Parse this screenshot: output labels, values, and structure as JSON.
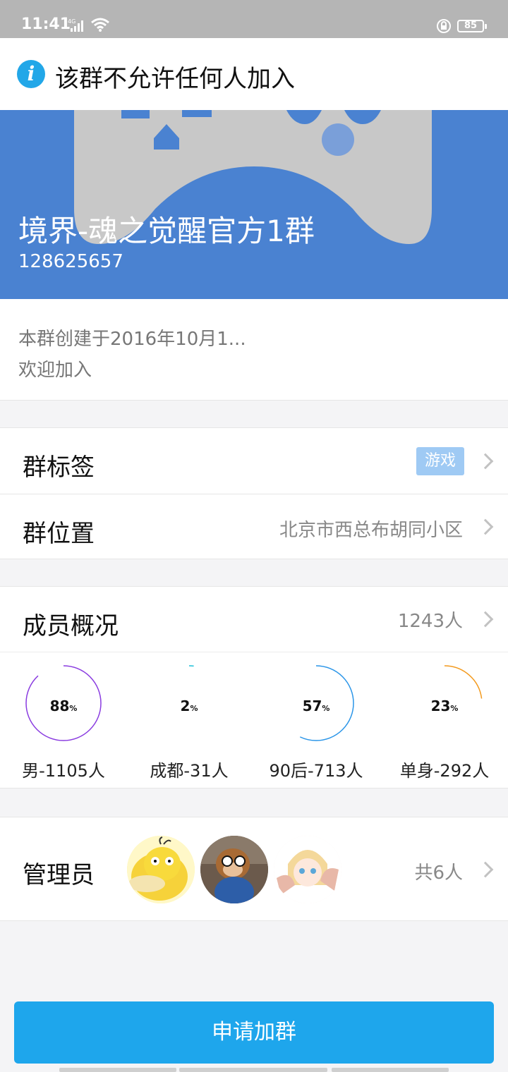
{
  "status_bar": {
    "time": "11:41",
    "network": "4G",
    "battery": "85"
  },
  "notice": {
    "icon": "info-icon",
    "text": "该群不允许任何人加入"
  },
  "group": {
    "name": "境界-魂之觉醒官方1群",
    "id": "128625657"
  },
  "intro": {
    "line1": "本群创建于2016年10月1...",
    "line2": "欢迎加入"
  },
  "tags": {
    "label": "群标签",
    "value": "游戏"
  },
  "location": {
    "label": "群位置",
    "value": "北京市西总布胡同小区"
  },
  "members": {
    "label": "成员概况",
    "count": "1243人",
    "stats": [
      {
        "percent": 88,
        "percent_text": "88",
        "label": "男-1105人",
        "color": "#8a3ce0"
      },
      {
        "percent": 2,
        "percent_text": "2",
        "label": "成都-31人",
        "color": "#1ec0d8"
      },
      {
        "percent": 57,
        "percent_text": "57",
        "label": "90后-713人",
        "color": "#2a95e8"
      },
      {
        "percent": 23,
        "percent_text": "23",
        "label": "单身-292人",
        "color": "#f39a1e"
      }
    ]
  },
  "admins": {
    "label": "管理员",
    "count": "共6人"
  },
  "apply_button": "申请加群",
  "colors": {
    "banner": "#4a82d1",
    "button": "#1ea6ec",
    "tag": "#9fcaf4"
  }
}
